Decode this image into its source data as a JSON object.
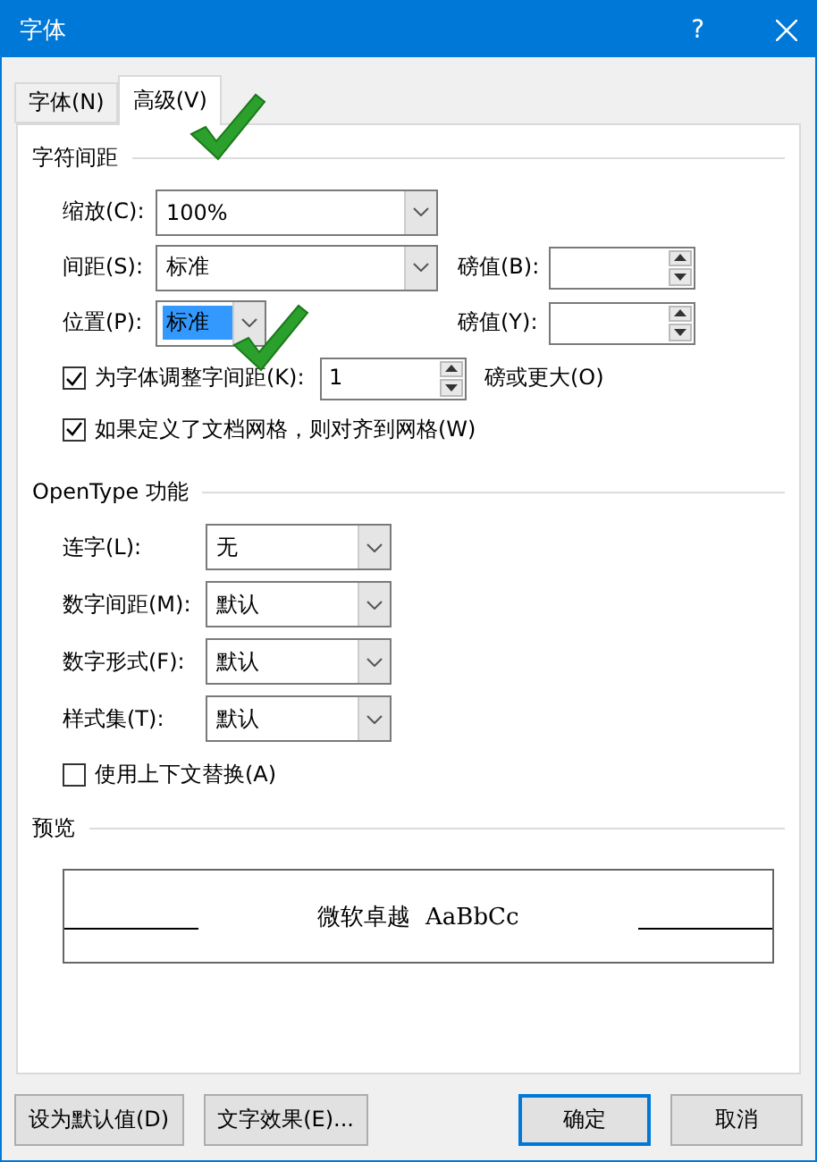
{
  "window": {
    "title": "字体",
    "help": "?"
  },
  "tabs": [
    {
      "label": "字体(N)",
      "selected": false,
      "check_mark": false
    },
    {
      "label": "高级(V)",
      "selected": true,
      "check_mark": true
    }
  ],
  "character_spacing": {
    "title": "字符间距",
    "rows": [
      {
        "label": "缩放(C):",
        "value": "100%",
        "wide": true,
        "highlighted": false,
        "check_mark": false
      },
      {
        "label": "间距(S):",
        "value": "标准",
        "wide": true,
        "highlighted": false,
        "check_mark": false,
        "points_label": "磅值(B):"
      },
      {
        "label": "位置(P):",
        "value": "标准",
        "wide": false,
        "highlighted": true,
        "check_mark": true,
        "points_label": "磅值(Y):"
      }
    ],
    "kerning": {
      "label": "为字体调整字间距(K):",
      "checked": true,
      "value": "1",
      "suffix": "磅或更大(O)"
    },
    "snap_to_grid": {
      "label": "如果定义了文档网格，则对齐到网格(W)",
      "checked": true
    }
  },
  "opentype": {
    "title": "OpenType 功能",
    "selects": [
      {
        "label": "连字(L):",
        "value": "无"
      },
      {
        "label": "数字间距(M):",
        "value": "默认"
      },
      {
        "label": "数字形式(F):",
        "value": "默认"
      },
      {
        "label": "样式集(T):",
        "value": "默认"
      }
    ],
    "contextual": {
      "label": "使用上下文替换(A)",
      "checked": false
    }
  },
  "preview": {
    "title": "预览",
    "sample": "微软卓越  AaBbCc"
  },
  "buttons": [
    {
      "label": "设为默认值(D)",
      "default": false
    },
    {
      "label": "文字效果(E)...",
      "default": false
    },
    {
      "label": "确定",
      "default": true
    },
    {
      "label": "取消",
      "default": false
    }
  ]
}
